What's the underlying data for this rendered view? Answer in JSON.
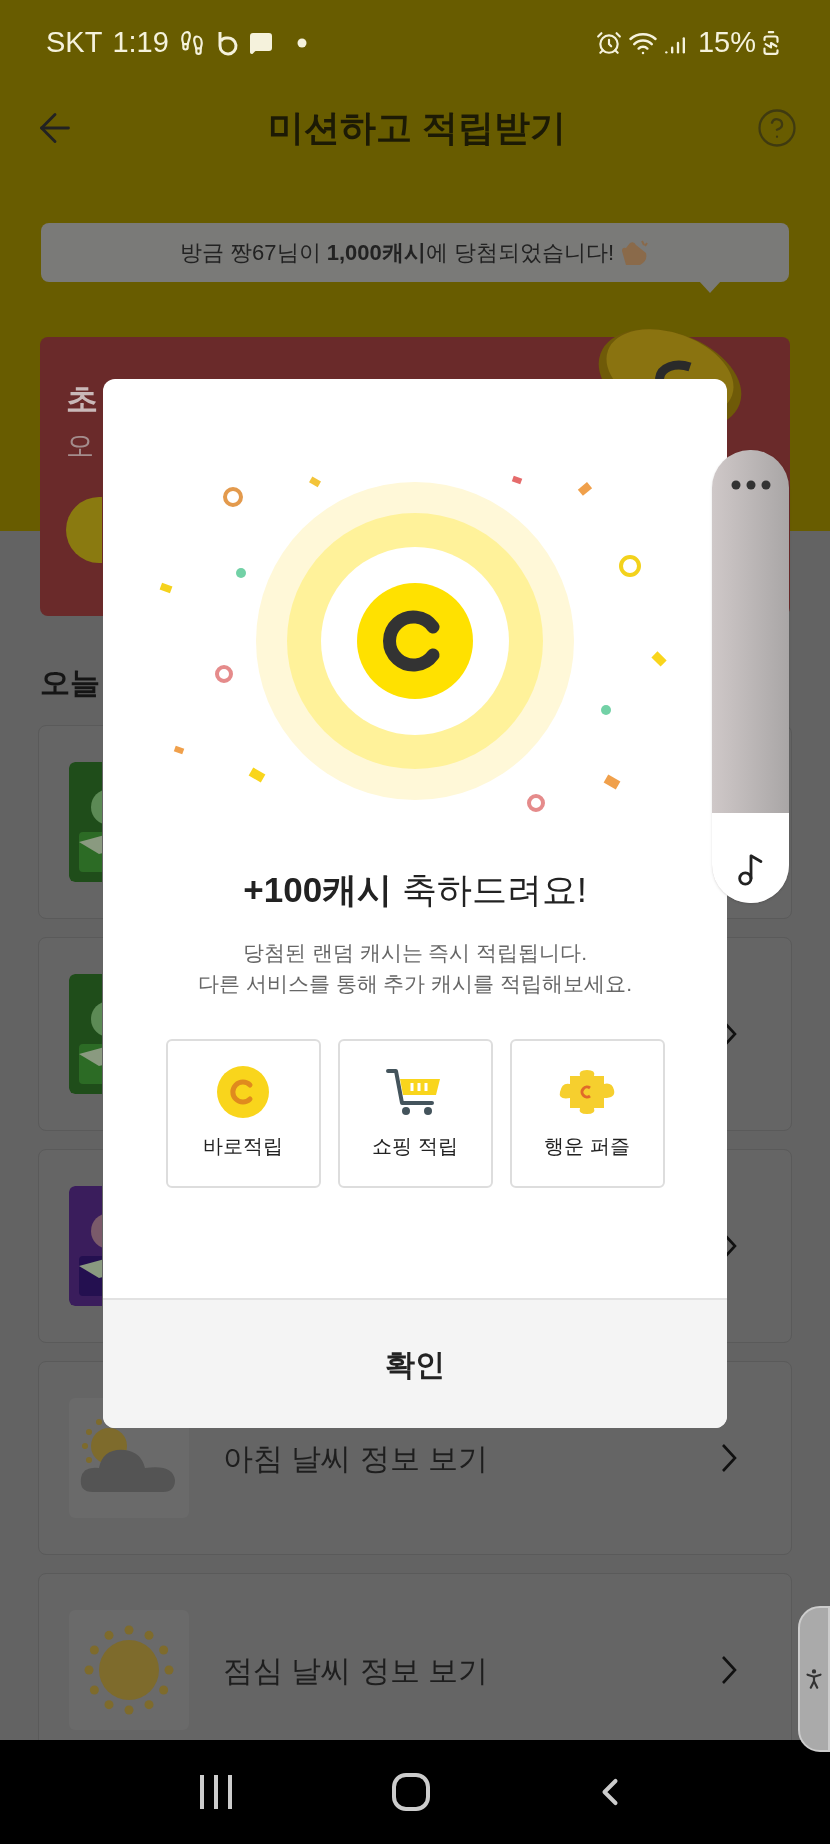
{
  "status_bar": {
    "carrier": "SKT",
    "time": "1:19",
    "battery": "15%"
  },
  "header": {
    "title": "미션하고 적립받기"
  },
  "toast": {
    "text": "방금 짱67님이 **1,000캐시**에 당첨되었습니다!"
  },
  "promo_card": {
    "title": "초",
    "subtitle": "오"
  },
  "section": {
    "title": "오늘"
  },
  "missions": [
    {
      "kind": "running"
    },
    {
      "kind": "running",
      "chevron": true
    },
    {
      "kind": "video",
      "chevron": true
    },
    {
      "kind": "weather_cloudy",
      "label": "아침 날씨 정보 보기",
      "chevron": true
    },
    {
      "kind": "weather_sunny",
      "label": "점심 날씨 정보 보기",
      "chevron": true
    }
  ],
  "dialog": {
    "title": "**+100캐시** 축하드려요!",
    "message": [
      "당첨된 랜덤 캐시는 즉시 적립됩니다.",
      "다른 서비스를 통해 추가 캐시를 적립해보세요."
    ],
    "services": [
      {
        "kind": "coin",
        "label": "바로적립"
      },
      {
        "kind": "cart",
        "label": "쇼핑 적립"
      },
      {
        "kind": "puzzle",
        "label": "행운 퍼즐"
      }
    ],
    "confirm": "확인"
  }
}
